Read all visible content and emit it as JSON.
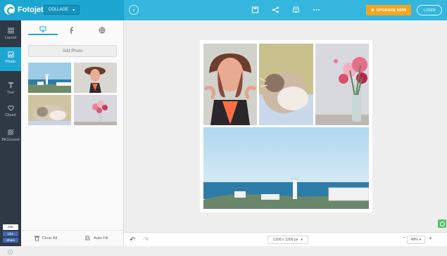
{
  "app": {
    "name": "Fotojet",
    "mode": "COLLAGE"
  },
  "header": {
    "upgrade": "UPGRADE NOW",
    "login": "LOGIN"
  },
  "leftnav": {
    "items": [
      {
        "label": "Layout"
      },
      {
        "label": "Photo"
      },
      {
        "label": "Text"
      },
      {
        "label": "Clipart"
      },
      {
        "label": "BKGround"
      }
    ]
  },
  "facebook": {
    "count": "24K",
    "like": "Like",
    "share": "Share"
  },
  "panel": {
    "add_photo": "Add Photo",
    "clear_all": "Clear All",
    "auto_fill": "Auto Fill"
  },
  "bottom": {
    "canvas_size": "1200 x 1200 px",
    "zoom": "48%"
  },
  "colors": {
    "topbar": "#34b6de",
    "topbar_left": "#1ea6d3",
    "nav": "#2f3845",
    "upgrade": "#f7a51c",
    "help": "#55c26b"
  }
}
